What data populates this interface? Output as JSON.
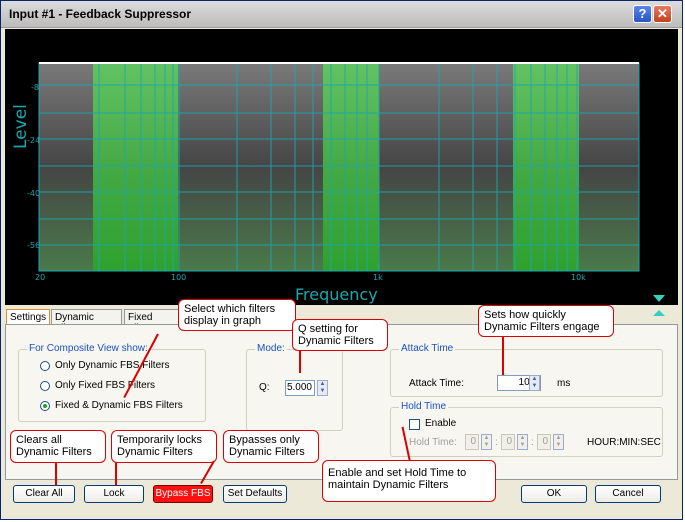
{
  "window": {
    "title": "Input #1 - Feedback Suppressor",
    "help_icon": "?",
    "close_icon": "✕"
  },
  "graph": {
    "ylabel": "Level",
    "xlabel": "Frequency",
    "y_ticks": [
      "-8",
      "-24",
      "-40",
      "-56"
    ],
    "x_ticks": [
      "20",
      "100",
      "1k",
      "10k"
    ]
  },
  "tabs": [
    "Settings",
    "Dynamic Filters",
    "Fixed Filters"
  ],
  "composite": {
    "title": "For Composite View show:",
    "options": [
      "Only Dynamic FBS Filters",
      "Only Fixed FBS Filters",
      "Fixed & Dynamic FBS Filters"
    ],
    "selected": 2
  },
  "mode": {
    "title": "Mode:",
    "q_label": "Q:",
    "q_value": "5.000"
  },
  "attack": {
    "title": "Attack Time",
    "label": "Attack Time:",
    "value": "10.0",
    "unit": "ms"
  },
  "hold": {
    "title": "Hold Time",
    "enable_label": "Enable",
    "time_label": "Hold Time:",
    "h": "0",
    "m": "0",
    "s": "0",
    "format": "HOUR:MIN:SEC"
  },
  "buttons": {
    "clear_all": "Clear All",
    "lock": "Lock",
    "bypass": "Bypass FBS",
    "set_defaults": "Set Defaults",
    "ok": "OK",
    "cancel": "Cancel"
  },
  "callouts": {
    "select_filters": "Select which filters display in graph",
    "q_setting": "Q setting for Dynamic Filters",
    "attack": "Sets how quickly Dynamic Filters engage",
    "clears": "Clears all Dynamic Filters",
    "locks": "Temporarily locks Dynamic Filters",
    "bypass": "Bypasses only Dynamic Filters",
    "hold": "Enable and set Hold Time to maintain Dynamic Filters"
  },
  "colors": {
    "graph_bg": "#000000",
    "grid": "#1aa7b0",
    "filter_band": "#36d04a",
    "callout_border": "#dd0000",
    "bypass": "#ff1010"
  }
}
